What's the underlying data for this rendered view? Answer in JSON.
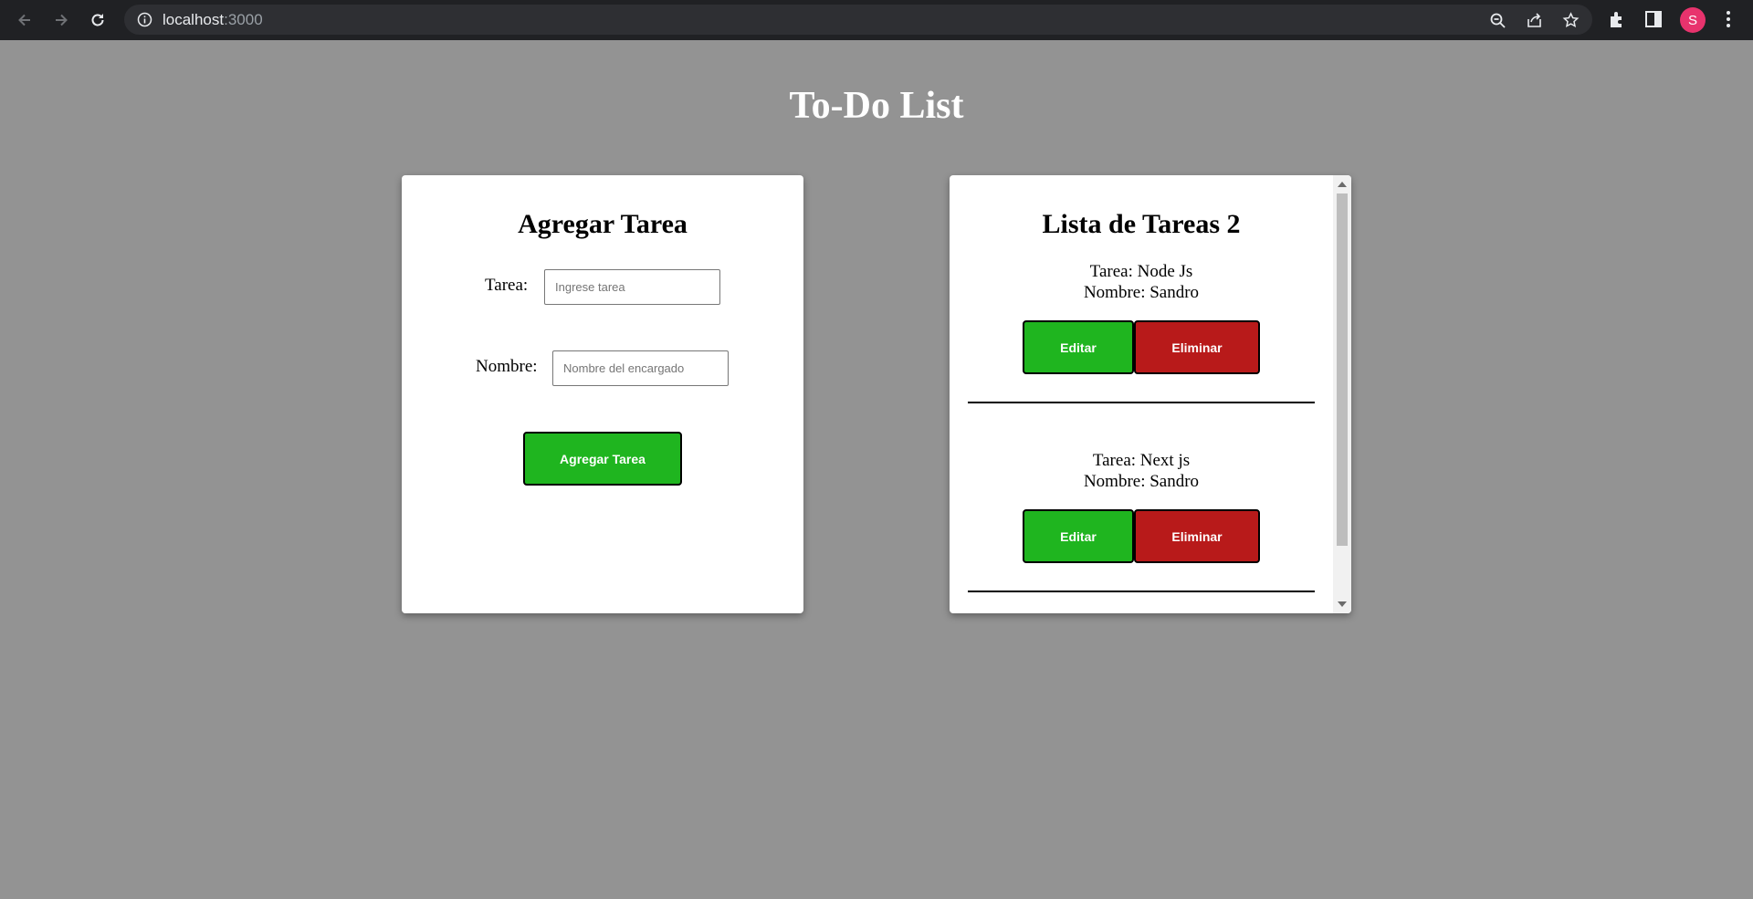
{
  "browser": {
    "url_host": "localhost",
    "url_port": ":3000",
    "avatar_initial": "S",
    "icons": [
      "back-icon",
      "forward-icon",
      "reload-icon",
      "info-icon",
      "zoom-out-icon",
      "share-icon",
      "star-icon",
      "extensions-icon",
      "side-panel-icon",
      "menu-icon"
    ]
  },
  "page": {
    "title": "To-Do List"
  },
  "add_form": {
    "heading": "Agregar Tarea",
    "task_label": "Tarea:",
    "task_placeholder": "Ingrese tarea",
    "name_label": "Nombre:",
    "name_placeholder": "Nombre del encargado",
    "submit_label": "Agregar Tarea"
  },
  "task_list": {
    "heading": "Lista de Tareas 2",
    "items": [
      {
        "task": "Tarea: Node Js",
        "name": "Nombre: Sandro",
        "edit_label": "Editar",
        "delete_label": "Eliminar"
      },
      {
        "task": "Tarea: Next js",
        "name": "Nombre: Sandro",
        "edit_label": "Editar",
        "delete_label": "Eliminar"
      }
    ]
  },
  "colors": {
    "page_background": "#939393",
    "edit_button": "#1fb51f",
    "delete_button": "#b81a1a",
    "submit_button": "#1fb51f",
    "avatar": "#e8336d"
  }
}
